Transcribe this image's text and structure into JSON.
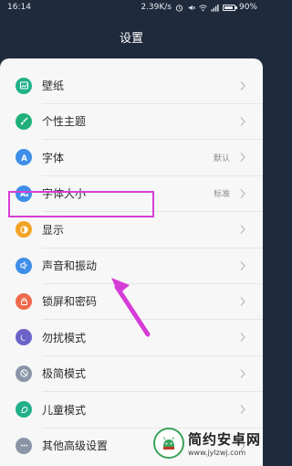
{
  "status_bar": {
    "time": "16:14",
    "speed": "2.39K/s",
    "battery": "90%"
  },
  "header": {
    "title": "设置"
  },
  "settings": [
    {
      "label": "壁纸",
      "value": "",
      "icon": "wallpaper-icon",
      "color": "#21b08a"
    },
    {
      "label": "个性主题",
      "value": "",
      "icon": "theme-brush-icon",
      "color": "#1fb07a"
    },
    {
      "label": "字体",
      "value": "默认",
      "icon": "font-icon",
      "color": "#3f8ee8"
    },
    {
      "label": "字体大小",
      "value": "标准",
      "icon": "font-size-icon",
      "color": "#3f8ee8"
    },
    {
      "label": "显示",
      "value": "",
      "icon": "display-icon",
      "color": "#f3a325"
    },
    {
      "label": "声音和振动",
      "value": "",
      "icon": "speaker-icon",
      "color": "#3f8ee8"
    },
    {
      "label": "锁屏和密码",
      "value": "",
      "icon": "lock-icon",
      "color": "#ef6a4c"
    },
    {
      "label": "勿扰模式",
      "value": "",
      "icon": "moon-icon",
      "color": "#6c63c8"
    },
    {
      "label": "极简模式",
      "value": "",
      "icon": "minimal-mode-icon",
      "color": "#8a96a8"
    },
    {
      "label": "儿童模式",
      "value": "",
      "icon": "child-mode-icon",
      "color": "#21b08a"
    },
    {
      "label": "其他高级设置",
      "value": "",
      "icon": "more-dots-icon",
      "color": "#8a96a8"
    }
  ],
  "watermark": {
    "title": "简约安卓网",
    "url": "www.jylzwj.com"
  },
  "colors": {
    "highlight": "#d63dd6",
    "header_bg": "#1f2a3c"
  }
}
